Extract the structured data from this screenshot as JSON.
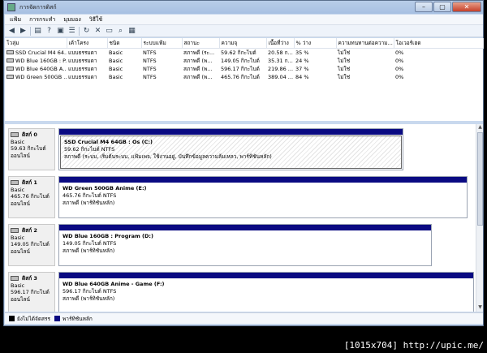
{
  "window": {
    "title": "การจัดการดิสก์",
    "min": "–",
    "max": "▢",
    "close": "✕"
  },
  "menu": [
    "แฟ้ม",
    "การกระทำ",
    "มุมมอง",
    "วิธีใช้"
  ],
  "toolbar": [
    "back-icon",
    "forward-icon",
    "list-icon",
    "help-icon",
    "properties-icon",
    "list2-icon",
    "refresh-icon",
    "delete-icon",
    "folder-icon",
    "rescan-icon",
    "view-icon"
  ],
  "columns": [
    "โวลุ่ม",
    "เค้าโครง",
    "ชนิด",
    "ระบบแฟ้ม",
    "สถานะ",
    "ความจุ",
    "เนื้อที่ว่าง",
    "% ว่าง",
    "ความทนทานต่อความ...",
    "โอเวอร์เฮด"
  ],
  "volumes": [
    [
      "SSD Crucial M4 64...",
      "แบบธรรมดา",
      "Basic",
      "NTFS",
      "สภาพดี (ระ...",
      "59.62 กิกะไบต์",
      "20.58 ก...",
      "35 %",
      "ไม่ใช่",
      "0%"
    ],
    [
      "WD Blue 160GB : P...",
      "แบบธรรมดา",
      "Basic",
      "NTFS",
      "สภาพดี (พ...",
      "149.05 กิกะไบต์",
      "35.31 ก...",
      "24 %",
      "ไม่ใช่",
      "0%"
    ],
    [
      "WD Blue 640GB A...",
      "แบบธรรมดา",
      "Basic",
      "NTFS",
      "สภาพดี (พ...",
      "596.17 กิกะไบต์",
      "219.86 ...",
      "37 %",
      "ไม่ใช่",
      "0%"
    ],
    [
      "WD Green 500GB ...",
      "แบบธรรมดา",
      "Basic",
      "NTFS",
      "สภาพดี (พ...",
      "465.76 กิกะไบต์",
      "389.04 ...",
      "84 %",
      "ไม่ใช่",
      "0%"
    ]
  ],
  "disks": [
    {
      "name": "ดิสก์ 0",
      "type": "Basic",
      "size": "59.63 กิกะไบต์",
      "status": "ออนไลน์",
      "part_title": "SSD Crucial M4 64GB : Os  (C:)",
      "part_size": "59.62 กิกะไบต์ NTFS",
      "part_status": "สภาพดี (ระบบ, เริ่มต้นระบบ, แฟ้มเพจ, ใช้งานอยู่, บันทึกข้อมูลความล้มเหลว, พาร์ทิชันหลัก)"
    },
    {
      "name": "ดิสก์ 1",
      "type": "Basic",
      "size": "465.76 กิกะไบต์",
      "status": "ออนไลน์",
      "part_title": "WD Green 500GB Anime  (E:)",
      "part_size": "465.76 กิกะไบต์ NTFS",
      "part_status": "สภาพดี (พาร์ทิชันหลัก)"
    },
    {
      "name": "ดิสก์ 2",
      "type": "Basic",
      "size": "149.05 กิกะไบต์",
      "status": "ออนไลน์",
      "part_title": "WD Blue 160GB : Program  (D:)",
      "part_size": "149.05 กิกะไบต์ NTFS",
      "part_status": "สภาพดี (พาร์ทิชันหลัก)"
    },
    {
      "name": "ดิสก์ 3",
      "type": "Basic",
      "size": "596.17 กิกะไบต์",
      "status": "ออนไลน์",
      "part_title": "WD Blue 640GB Anime - Game  (F:)",
      "part_size": "596.17 กิกะไบต์ NTFS",
      "part_status": "สภาพดี (พาร์ทิชันหลัก)"
    }
  ],
  "legend": [
    {
      "label": "ยังไม่ได้จัดสรร",
      "color": "#000000"
    },
    {
      "label": "พาร์ทิชันหลัก",
      "color": "#0a0a82"
    }
  ],
  "watermark": "[1015x704] http://upic.me/"
}
